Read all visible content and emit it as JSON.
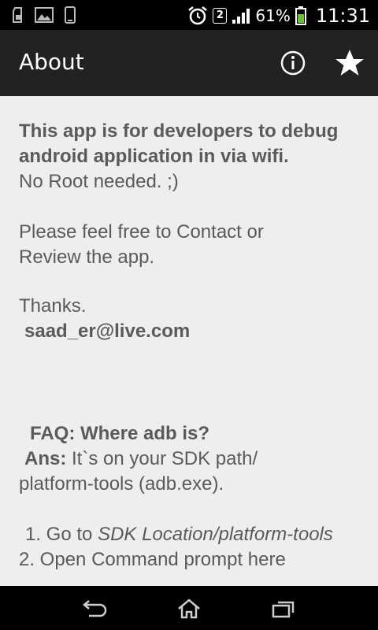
{
  "status_bar": {
    "notification_badge": "2",
    "battery": "61%",
    "time": "11:31",
    "icons": [
      "sd-card-icon",
      "image-icon",
      "phone-icon",
      "alarm-icon",
      "signal-icon",
      "battery-icon"
    ]
  },
  "action_bar": {
    "title": "About",
    "icons": [
      "info-icon",
      "star-icon"
    ]
  },
  "content": {
    "intro_bold_line1": "This app is for developers to debug",
    "intro_bold_line2": "android application in via wifi.",
    "no_root": "No Root needed. ;)",
    "contact_line1": "Please feel free to Contact or",
    "contact_line2": "Review the app.",
    "thanks": "Thanks.",
    "email": "saad_er@live.com",
    "faq_question": "FAQ: Where adb is?",
    "faq_ans_label": "Ans:",
    "faq_ans_text": " It`s on your SDK path/",
    "faq_ans_line2": "platform-tools (adb.exe).",
    "step1_prefix": "1. Go to ",
    "step1_path": "SDK Location/platform-tools",
    "step2": "2. Open Command prompt here"
  },
  "nav_bar": {
    "icons": [
      "back-icon",
      "home-icon",
      "recent-apps-icon"
    ]
  },
  "colors": {
    "content_bg": "#eeeeee",
    "text": "#5a5a5a",
    "action_bar_bg": "#222222",
    "battery_green": "#6fbf3a"
  }
}
